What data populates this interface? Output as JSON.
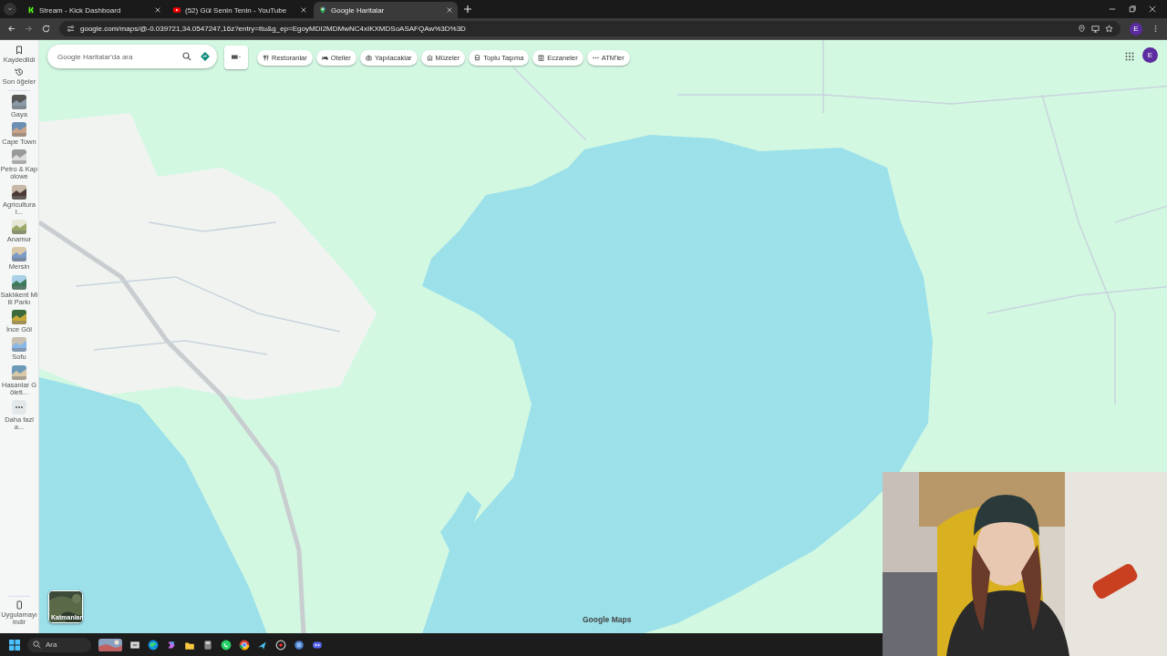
{
  "browser": {
    "tabs": [
      {
        "title": "Stream - Kick Dashboard",
        "kind": "kick",
        "selected": false
      },
      {
        "title": "(52) Gül Senin Tenin - YouTube",
        "kind": "youtube",
        "selected": false
      },
      {
        "title": "Google Haritalar",
        "kind": "maps",
        "selected": true
      }
    ],
    "url": "google.com/maps/@-0.039721,34.0547247,16z?entry=ttu&g_ep=EgoyMDI2MDMwNC4xIKXMDSoASAFQAw%3D%3D",
    "profile": "E"
  },
  "maps": {
    "search": {
      "placeholder": "Google Haritalar'da ara"
    },
    "chips": [
      {
        "label": "Restoranlar",
        "kind": "fork"
      },
      {
        "label": "Oteller",
        "kind": "bed"
      },
      {
        "label": "Yapılacaklar",
        "kind": "camera"
      },
      {
        "label": "Müzeler",
        "kind": "museum"
      },
      {
        "label": "Toplu Taşıma",
        "kind": "bus"
      },
      {
        "label": "Eczaneler",
        "kind": "pharmacy"
      },
      {
        "label": "ATM'ler",
        "kind": "dots"
      }
    ],
    "sidebar": [
      {
        "label": "Kaydedildi",
        "kind": "bookmark"
      },
      {
        "label": "Son öğeler",
        "kind": "history"
      },
      {
        "label": "Gaya",
        "kind": "place"
      },
      {
        "label": "Cape Town",
        "kind": "place"
      },
      {
        "label": "Petro & Kapolowe",
        "kind": "place"
      },
      {
        "label": "Agricultural...",
        "kind": "place"
      },
      {
        "label": "Anamur",
        "kind": "place"
      },
      {
        "label": "Mersin",
        "kind": "place"
      },
      {
        "label": "Saklıkent Milli Parkı",
        "kind": "place"
      },
      {
        "label": "İnce Göl",
        "kind": "place"
      },
      {
        "label": "Sofu",
        "kind": "place"
      },
      {
        "label": "Hasanlar Göleti...",
        "kind": "place"
      },
      {
        "label": "Daha fazla...",
        "kind": "more"
      }
    ],
    "download": {
      "label": "Uygulamayı indir"
    },
    "layers": {
      "label": "Katmanlar"
    },
    "account": "E",
    "attribution": "Google Maps"
  },
  "taskbar": {
    "search": "Ara"
  }
}
